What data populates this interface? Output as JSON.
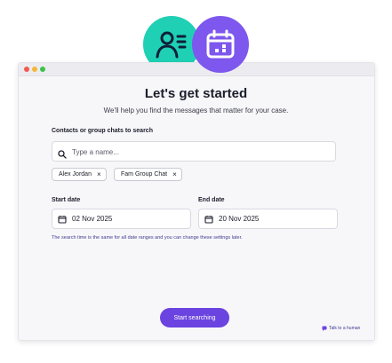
{
  "header": {
    "title": "Let's get started",
    "subtitle": "We'll help you find the messages that matter for your case."
  },
  "contacts": {
    "label": "Contacts or group chats to search",
    "placeholder": "Type a name...",
    "chips": [
      "Alex Jordan",
      "Fam Group Chat"
    ]
  },
  "dates": {
    "start_label": "Start date",
    "start_value": "02 Nov 2025",
    "end_label": "End date",
    "end_value": "20 Nov 2025",
    "note": "The search time is the same for all date ranges and you can change these settings later."
  },
  "actions": {
    "search_label": "Start searching",
    "help_label": "Talk to a human"
  },
  "colors": {
    "accent": "#6b43e0",
    "contact_avatar": "#1fd0b4",
    "calendar_avatar": "#7d57ee"
  },
  "icons": [
    "contact-icon",
    "calendar-icon",
    "search-icon",
    "close-icon",
    "chat-icon"
  ]
}
